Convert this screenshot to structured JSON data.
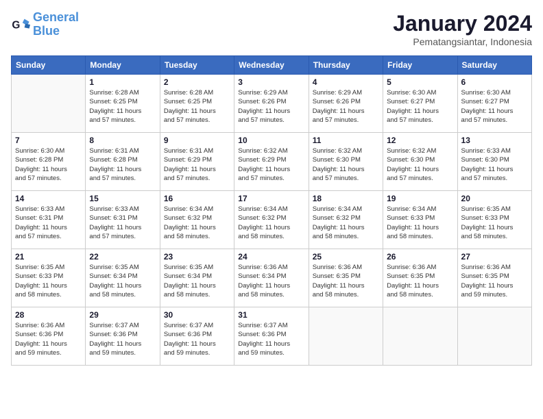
{
  "header": {
    "logo_line1": "General",
    "logo_line2": "Blue",
    "month": "January 2024",
    "location": "Pematangsiantar, Indonesia"
  },
  "days_of_week": [
    "Sunday",
    "Monday",
    "Tuesday",
    "Wednesday",
    "Thursday",
    "Friday",
    "Saturday"
  ],
  "weeks": [
    [
      {
        "day": "",
        "info": ""
      },
      {
        "day": "1",
        "info": "Sunrise: 6:28 AM\nSunset: 6:25 PM\nDaylight: 11 hours\nand 57 minutes."
      },
      {
        "day": "2",
        "info": "Sunrise: 6:28 AM\nSunset: 6:25 PM\nDaylight: 11 hours\nand 57 minutes."
      },
      {
        "day": "3",
        "info": "Sunrise: 6:29 AM\nSunset: 6:26 PM\nDaylight: 11 hours\nand 57 minutes."
      },
      {
        "day": "4",
        "info": "Sunrise: 6:29 AM\nSunset: 6:26 PM\nDaylight: 11 hours\nand 57 minutes."
      },
      {
        "day": "5",
        "info": "Sunrise: 6:30 AM\nSunset: 6:27 PM\nDaylight: 11 hours\nand 57 minutes."
      },
      {
        "day": "6",
        "info": "Sunrise: 6:30 AM\nSunset: 6:27 PM\nDaylight: 11 hours\nand 57 minutes."
      }
    ],
    [
      {
        "day": "7",
        "info": "Sunrise: 6:30 AM\nSunset: 6:28 PM\nDaylight: 11 hours\nand 57 minutes."
      },
      {
        "day": "8",
        "info": "Sunrise: 6:31 AM\nSunset: 6:28 PM\nDaylight: 11 hours\nand 57 minutes."
      },
      {
        "day": "9",
        "info": "Sunrise: 6:31 AM\nSunset: 6:29 PM\nDaylight: 11 hours\nand 57 minutes."
      },
      {
        "day": "10",
        "info": "Sunrise: 6:32 AM\nSunset: 6:29 PM\nDaylight: 11 hours\nand 57 minutes."
      },
      {
        "day": "11",
        "info": "Sunrise: 6:32 AM\nSunset: 6:30 PM\nDaylight: 11 hours\nand 57 minutes."
      },
      {
        "day": "12",
        "info": "Sunrise: 6:32 AM\nSunset: 6:30 PM\nDaylight: 11 hours\nand 57 minutes."
      },
      {
        "day": "13",
        "info": "Sunrise: 6:33 AM\nSunset: 6:30 PM\nDaylight: 11 hours\nand 57 minutes."
      }
    ],
    [
      {
        "day": "14",
        "info": "Sunrise: 6:33 AM\nSunset: 6:31 PM\nDaylight: 11 hours\nand 57 minutes."
      },
      {
        "day": "15",
        "info": "Sunrise: 6:33 AM\nSunset: 6:31 PM\nDaylight: 11 hours\nand 57 minutes."
      },
      {
        "day": "16",
        "info": "Sunrise: 6:34 AM\nSunset: 6:32 PM\nDaylight: 11 hours\nand 58 minutes."
      },
      {
        "day": "17",
        "info": "Sunrise: 6:34 AM\nSunset: 6:32 PM\nDaylight: 11 hours\nand 58 minutes."
      },
      {
        "day": "18",
        "info": "Sunrise: 6:34 AM\nSunset: 6:32 PM\nDaylight: 11 hours\nand 58 minutes."
      },
      {
        "day": "19",
        "info": "Sunrise: 6:34 AM\nSunset: 6:33 PM\nDaylight: 11 hours\nand 58 minutes."
      },
      {
        "day": "20",
        "info": "Sunrise: 6:35 AM\nSunset: 6:33 PM\nDaylight: 11 hours\nand 58 minutes."
      }
    ],
    [
      {
        "day": "21",
        "info": "Sunrise: 6:35 AM\nSunset: 6:33 PM\nDaylight: 11 hours\nand 58 minutes."
      },
      {
        "day": "22",
        "info": "Sunrise: 6:35 AM\nSunset: 6:34 PM\nDaylight: 11 hours\nand 58 minutes."
      },
      {
        "day": "23",
        "info": "Sunrise: 6:35 AM\nSunset: 6:34 PM\nDaylight: 11 hours\nand 58 minutes."
      },
      {
        "day": "24",
        "info": "Sunrise: 6:36 AM\nSunset: 6:34 PM\nDaylight: 11 hours\nand 58 minutes."
      },
      {
        "day": "25",
        "info": "Sunrise: 6:36 AM\nSunset: 6:35 PM\nDaylight: 11 hours\nand 58 minutes."
      },
      {
        "day": "26",
        "info": "Sunrise: 6:36 AM\nSunset: 6:35 PM\nDaylight: 11 hours\nand 58 minutes."
      },
      {
        "day": "27",
        "info": "Sunrise: 6:36 AM\nSunset: 6:35 PM\nDaylight: 11 hours\nand 59 minutes."
      }
    ],
    [
      {
        "day": "28",
        "info": "Sunrise: 6:36 AM\nSunset: 6:36 PM\nDaylight: 11 hours\nand 59 minutes."
      },
      {
        "day": "29",
        "info": "Sunrise: 6:37 AM\nSunset: 6:36 PM\nDaylight: 11 hours\nand 59 minutes."
      },
      {
        "day": "30",
        "info": "Sunrise: 6:37 AM\nSunset: 6:36 PM\nDaylight: 11 hours\nand 59 minutes."
      },
      {
        "day": "31",
        "info": "Sunrise: 6:37 AM\nSunset: 6:36 PM\nDaylight: 11 hours\nand 59 minutes."
      },
      {
        "day": "",
        "info": ""
      },
      {
        "day": "",
        "info": ""
      },
      {
        "day": "",
        "info": ""
      }
    ]
  ]
}
